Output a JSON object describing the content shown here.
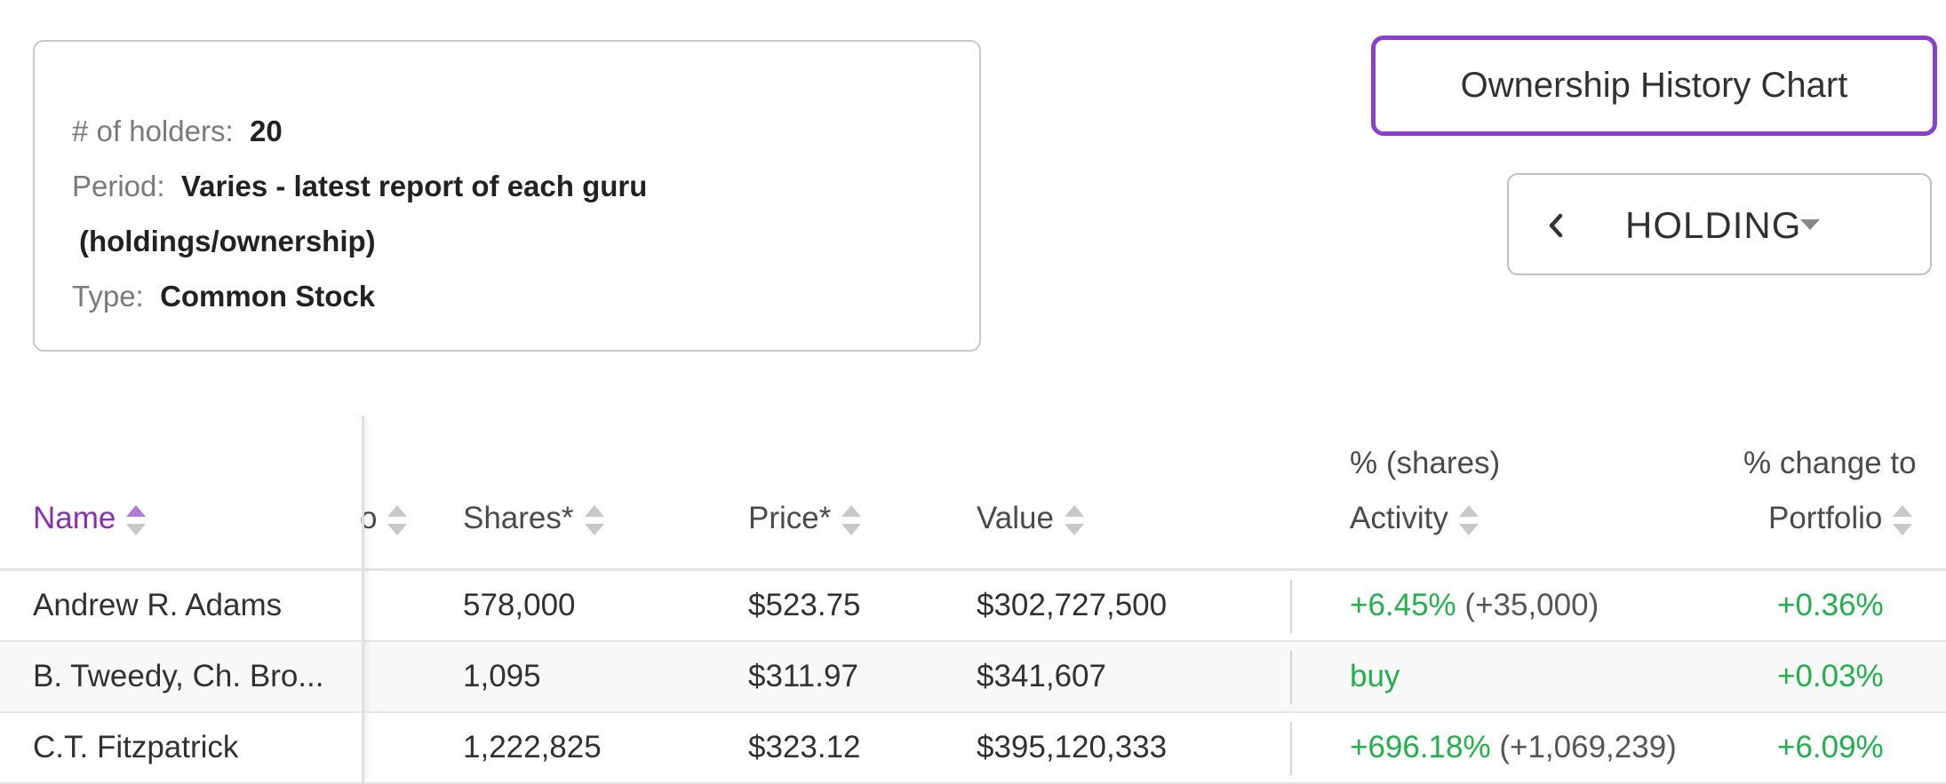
{
  "summary": {
    "holders_label": "# of holders:",
    "holders_value": "20",
    "period_label": "Period:",
    "period_value_line1": "Varies - latest report of each guru",
    "period_value_line2": "(holdings/ownership)",
    "type_label": "Type:",
    "type_value": "Common Stock"
  },
  "controls": {
    "history_chart_label": "Ownership History Chart",
    "view_select_value": "HOLDING"
  },
  "table": {
    "headers": {
      "name": "Name",
      "portfolio_partial": "o",
      "shares": "Shares*",
      "price": "Price*",
      "value": "Value",
      "activity_line1": "% (shares)",
      "activity_line2": "Activity",
      "change_line1": "% change to",
      "change_line2": "Portfolio"
    },
    "rows": [
      {
        "name": "Andrew R. Adams",
        "shares": "578,000",
        "price": "$523.75",
        "value": "$302,727,500",
        "activity_pct": "+6.45%",
        "activity_shares": "(+35,000)",
        "change": "+0.36%"
      },
      {
        "name": "B. Tweedy, Ch. Bro...",
        "shares": "1,095",
        "price": "$311.97",
        "value": "$341,607",
        "activity_pct": "buy",
        "activity_shares": "",
        "change": "+0.03%"
      },
      {
        "name": "C.T. Fitzpatrick",
        "shares": "1,222,825",
        "price": "$323.12",
        "value": "$395,120,333",
        "activity_pct": "+696.18%",
        "activity_shares": "(+1,069,239)",
        "change": "+6.09%"
      }
    ]
  },
  "colors": {
    "accent": "#8a3fd1",
    "positive": "#1fb24a"
  }
}
